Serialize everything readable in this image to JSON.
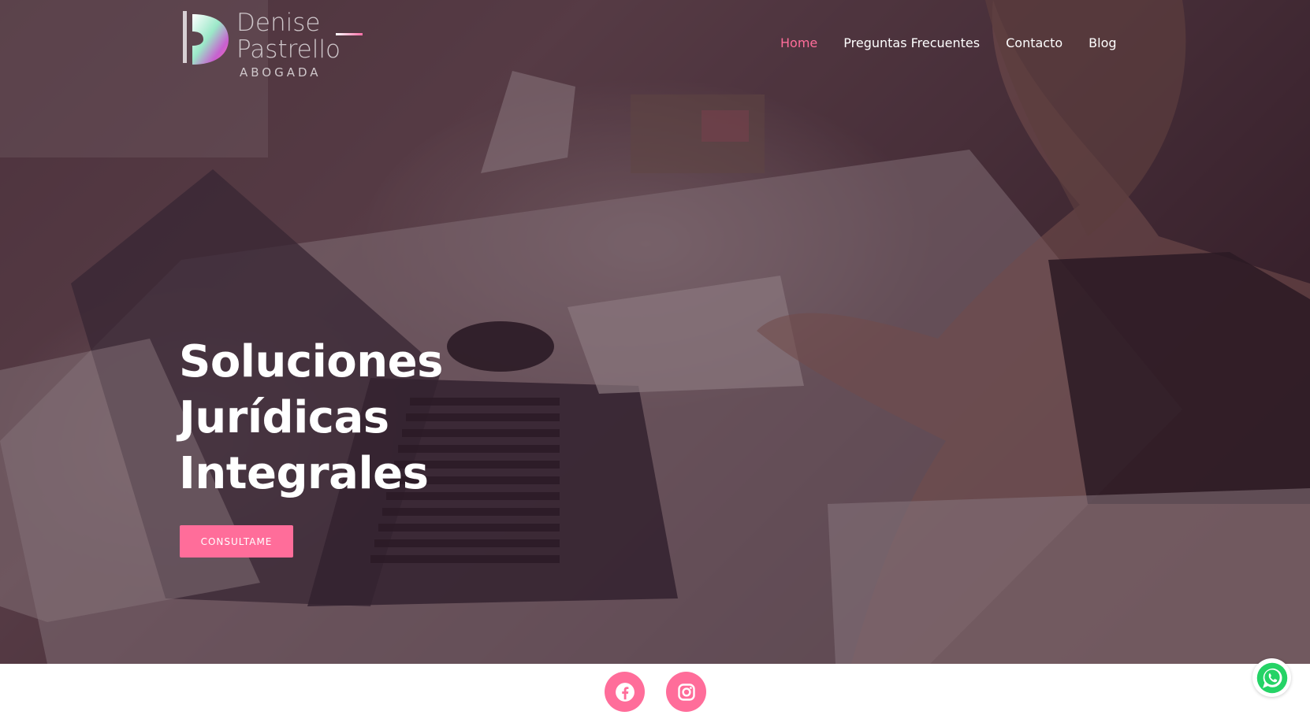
{
  "brand": {
    "name_line1": "Denise",
    "name_line2": "Pastrello",
    "subtitle": "ABOGADA",
    "accent_color": "#ff6d9a"
  },
  "nav": {
    "items": [
      {
        "label": "Home",
        "active": true
      },
      {
        "label": "Preguntas Frecuentes",
        "active": false
      },
      {
        "label": "Contacto",
        "active": false
      },
      {
        "label": "Blog",
        "active": false
      }
    ]
  },
  "hero": {
    "title_line1": "Soluciones",
    "title_line2": "Jurídicas",
    "title_line3": "Integrales",
    "cta_label": "CONSULTAME",
    "background": "photo-woman-at-desk-with-laptop"
  },
  "social": {
    "facebook_icon": "facebook-icon",
    "instagram_icon": "instagram-icon"
  },
  "floating": {
    "whatsapp_icon": "whatsapp-icon"
  }
}
